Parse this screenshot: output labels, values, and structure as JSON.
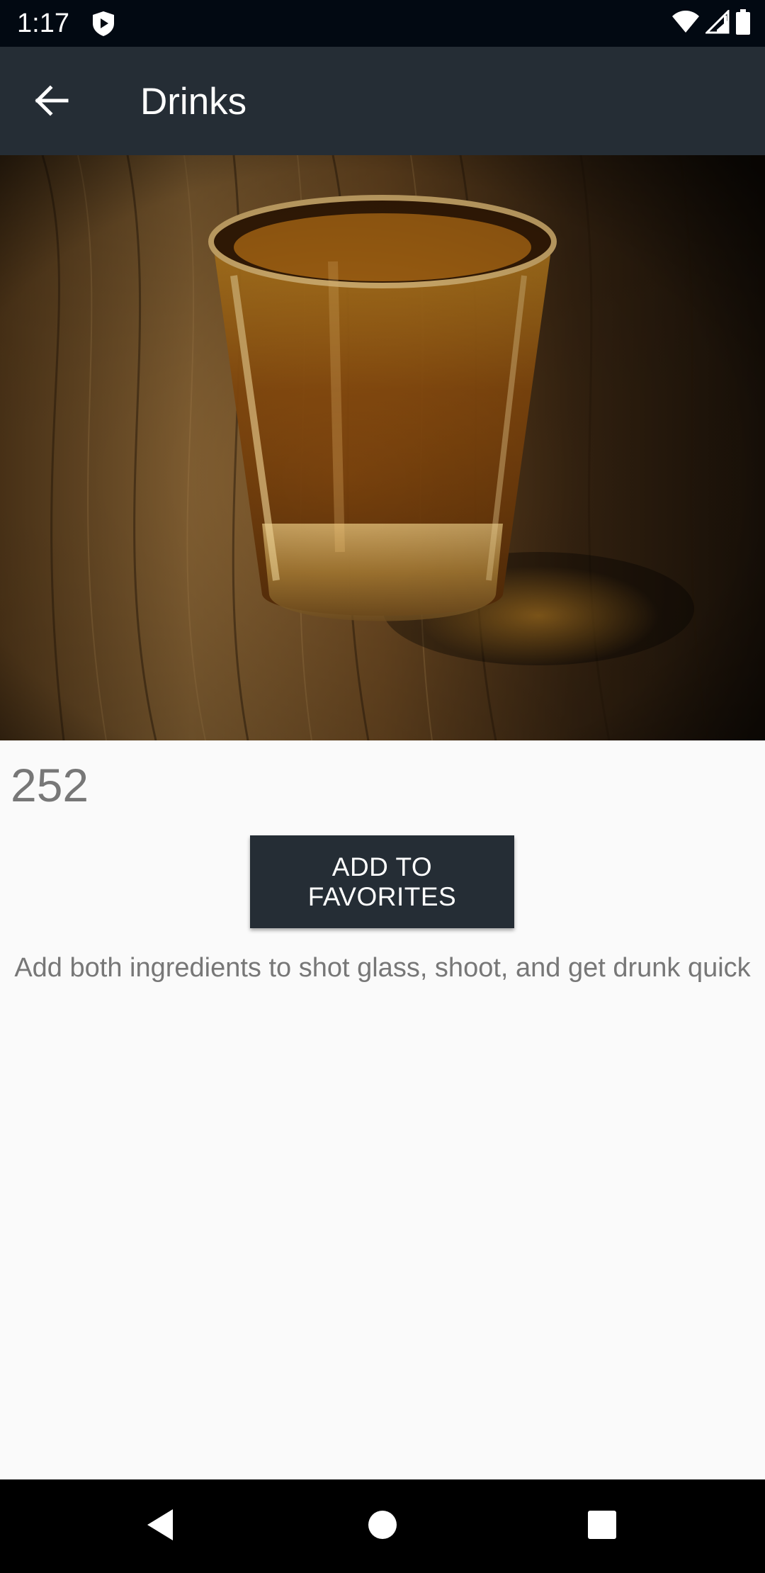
{
  "status_bar": {
    "time": "1:17",
    "icons": [
      "shield-play-icon",
      "wifi-icon",
      "signal-icon",
      "battery-icon"
    ]
  },
  "app_bar": {
    "title": "Drinks",
    "back_icon": "arrow-back-icon"
  },
  "hero_image": {
    "subject": "shot-glass-image"
  },
  "drink": {
    "count": "252",
    "button_label": "ADD TO FAVORITES",
    "instructions": "Add both ingredients to shot glass, shoot, and get drunk quick"
  },
  "nav_bar": {
    "icons": [
      "back-triangle-icon",
      "home-circle-icon",
      "recents-square-icon"
    ]
  },
  "colors": {
    "app_bar": "#252d35",
    "status_bar": "#020912",
    "background": "#fafafa",
    "text_secondary": "#777777",
    "button": "#252d35"
  }
}
